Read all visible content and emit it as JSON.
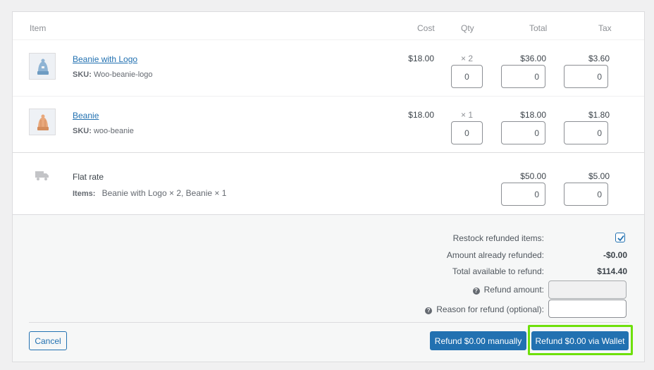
{
  "headers": {
    "item": "Item",
    "cost": "Cost",
    "qty": "Qty",
    "total": "Total",
    "tax": "Tax"
  },
  "line_items": [
    {
      "name": "Beanie with Logo",
      "sku_label": "SKU:",
      "sku": "Woo-beanie-logo",
      "cost": "$18.00",
      "qty": "× 2",
      "total": "$36.00",
      "tax": "$3.60",
      "refund_qty": "0",
      "refund_total": "0",
      "refund_tax": "0"
    },
    {
      "name": "Beanie",
      "sku_label": "SKU:",
      "sku": "woo-beanie",
      "cost": "$18.00",
      "qty": "× 1",
      "total": "$18.00",
      "tax": "$1.80",
      "refund_qty": "0",
      "refund_total": "0",
      "refund_tax": "0"
    }
  ],
  "shipping": {
    "name": "Flat rate",
    "items_label": "Items:",
    "items": "Beanie with Logo × 2, Beanie × 1",
    "total": "$50.00",
    "tax": "$5.00",
    "refund_total": "0",
    "refund_tax": "0"
  },
  "summary": {
    "restock_label": "Restock refunded items:",
    "restock_checked": true,
    "already_refunded_label": "Amount already refunded:",
    "already_refunded": "-$0.00",
    "available_label": "Total available to refund:",
    "available": "$114.40",
    "refund_amount_label": "Refund amount:",
    "refund_amount_value": "",
    "reason_label": "Reason for refund (optional):",
    "reason_value": ""
  },
  "actions": {
    "cancel": "Cancel",
    "refund_manual": "Refund $0.00 manually",
    "refund_wallet": "Refund $0.00 via Wallet"
  },
  "colors": {
    "accent": "#2271b1",
    "highlight": "#6ee00b"
  }
}
